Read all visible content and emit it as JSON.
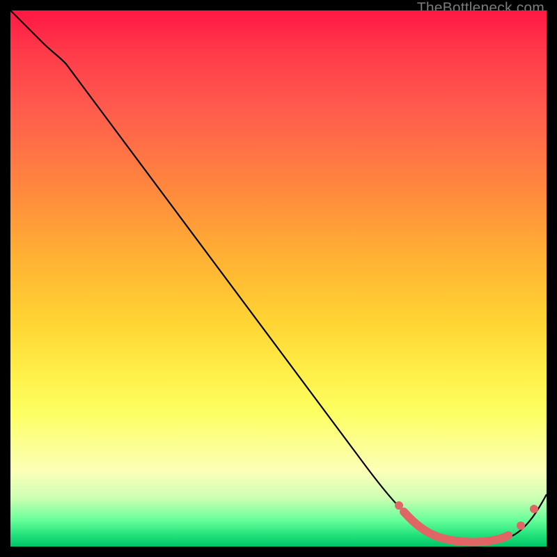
{
  "watermark": "TheBottleneck.com",
  "chart_data": {
    "type": "line",
    "title": "",
    "xlabel": "",
    "ylabel": "",
    "xlim": [
      0,
      100
    ],
    "ylim": [
      0,
      100
    ],
    "grid": false,
    "legend": false,
    "series": [
      {
        "name": "bottleneck-curve",
        "x": [
          0,
          6,
          10,
          20,
          30,
          40,
          50,
          60,
          70,
          76,
          80,
          84,
          88,
          92,
          96,
          100
        ],
        "y": [
          100,
          94,
          90,
          77,
          64,
          51,
          38,
          25,
          12,
          4,
          1,
          0,
          0,
          0,
          4,
          10
        ]
      }
    ],
    "highlight_points": {
      "name": "optimal-range-markers",
      "x": [
        74,
        76,
        78,
        80,
        82,
        84,
        86,
        88,
        90,
        92,
        94,
        96,
        98
      ],
      "y": [
        5,
        3,
        2,
        1,
        0,
        0,
        0,
        0,
        0,
        0,
        2,
        4,
        7
      ]
    }
  }
}
